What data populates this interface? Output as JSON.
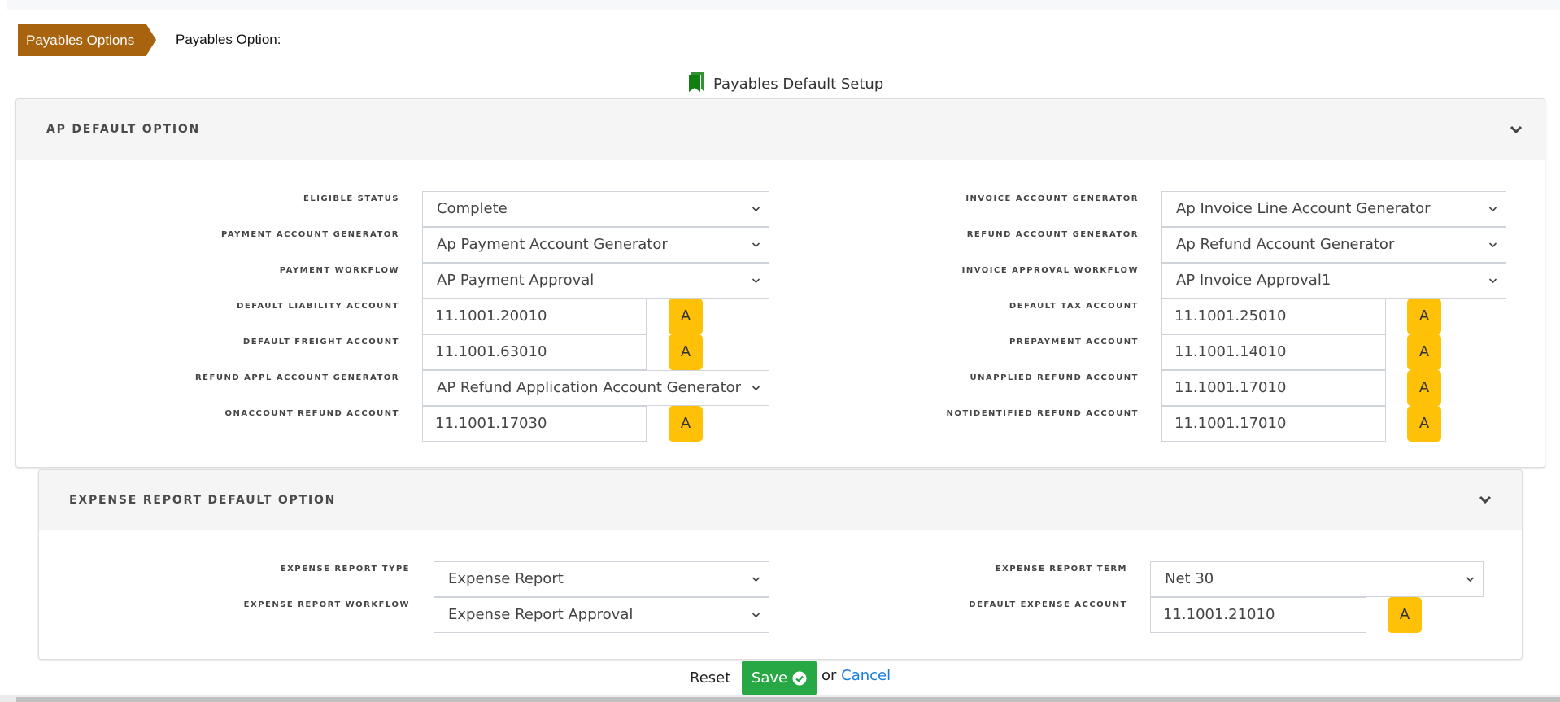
{
  "breadcrumb": {
    "label": "Payables Options",
    "current": "Payables Option:"
  },
  "page_title": "Payables Default Setup",
  "colors": {
    "breadcrumb": "#a8630f",
    "assign_button": "#ffc107",
    "save_button": "#28a745",
    "link": "#1a7dde",
    "title_icon": "#0f7f12"
  },
  "ap_panel": {
    "title": "AP DEFAULT OPTION",
    "left": [
      {
        "label": "ELIGIBLE STATUS",
        "type": "select",
        "value": "Complete"
      },
      {
        "label": "PAYMENT ACCOUNT GENERATOR",
        "type": "select",
        "value": "Ap Payment Account Generator"
      },
      {
        "label": "PAYMENT WORKFLOW",
        "type": "select",
        "value": "AP Payment Approval"
      },
      {
        "label": "DEFAULT LIABILITY ACCOUNT",
        "type": "account",
        "value": "11.1001.20010",
        "button": "A"
      },
      {
        "label": "DEFAULT FREIGHT ACCOUNT",
        "type": "account",
        "value": "11.1001.63010",
        "button": "A"
      },
      {
        "label": "REFUND APPL ACCOUNT GENERATOR",
        "type": "select",
        "value": "AP Refund Application Account Generator"
      },
      {
        "label": "ONACCOUNT REFUND ACCOUNT",
        "type": "account",
        "value": "11.1001.17030",
        "button": "A"
      }
    ],
    "right": [
      {
        "label": "INVOICE ACCOUNT GENERATOR",
        "type": "select",
        "value": "Ap Invoice Line Account Generator"
      },
      {
        "label": "REFUND ACCOUNT GENERATOR",
        "type": "select",
        "value": "Ap Refund Account Generator"
      },
      {
        "label": "INVOICE APPROVAL WORKFLOW",
        "type": "select",
        "value": "AP Invoice Approval1"
      },
      {
        "label": "DEFAULT TAX ACCOUNT",
        "type": "account",
        "value": "11.1001.25010",
        "button": "A"
      },
      {
        "label": "PREPAYMENT ACCOUNT",
        "type": "account",
        "value": "11.1001.14010",
        "button": "A"
      },
      {
        "label": "UNAPPLIED REFUND ACCOUNT",
        "type": "account",
        "value": "11.1001.17010",
        "button": "A"
      },
      {
        "label": "NOTIDENTIFIED REFUND ACCOUNT",
        "type": "account",
        "value": "11.1001.17010",
        "button": "A"
      }
    ]
  },
  "expense_panel": {
    "title": "EXPENSE REPORT DEFAULT OPTION",
    "left": [
      {
        "label": "EXPENSE REPORT TYPE",
        "type": "select",
        "value": "Expense Report"
      },
      {
        "label": "EXPENSE REPORT WORKFLOW",
        "type": "select",
        "value": "Expense Report Approval"
      }
    ],
    "right": [
      {
        "label": "EXPENSE REPORT TERM",
        "type": "select",
        "value": "Net 30"
      },
      {
        "label": "DEFAULT EXPENSE ACCOUNT",
        "type": "account",
        "value": "11.1001.21010",
        "button": "A"
      }
    ]
  },
  "footer": {
    "reset": "Reset",
    "save": "Save",
    "or": "or",
    "cancel": "Cancel"
  }
}
